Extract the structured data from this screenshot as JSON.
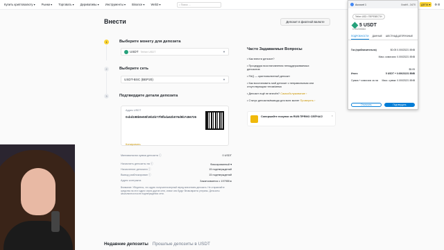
{
  "topnav": {
    "items": [
      "Купить криптовалюту ▾",
      "Рынки ▾",
      "Торговать ▾",
      "Деривативы ▾",
      "Инструменты ▾",
      "Binance ▾",
      "Web3 ▾"
    ],
    "search_placeholder": "Поиск ..."
  },
  "page": {
    "title": "Внести",
    "fiat_button": "Депозит в фиатной валюте"
  },
  "steps": [
    {
      "num": "1",
      "label": "Выберите монету для депозита"
    },
    {
      "num": "2",
      "label": "Выберите сеть"
    },
    {
      "num": "3",
      "label": "Подтвердите детали депозита"
    }
  ],
  "coin_select": {
    "value": "USDT",
    "sub": "Tether USDT"
  },
  "network_select": {
    "value": "USDT-BSC (BEP20)"
  },
  "address": {
    "label": "Адрес USDT",
    "value": "0xbd198b9e55f19b3b77f9fbda62b076d9b7456726",
    "copy": "Копировать"
  },
  "info_rows": [
    {
      "k": "Минимальная сумма депозита ⓘ",
      "v": "0 USDT"
    },
    {
      "k": "Начислить депозиты на ⓘ",
      "v": "Фиксированный ▾"
    },
    {
      "k": "Начисление депозита ⓘ",
      "v": "15 подтверждений"
    },
    {
      "k": "Вывод разблокирован ⓘ",
      "v": "15 подтверждений"
    },
    {
      "k": "Адрес контракта",
      "v": "Заканчивается с 197955 ▸"
    }
  ],
  "note": "Внимание: Убедитесь, что адрес получателя верный перед внесением депозита. Не отправляйте средства на этот адрес через другие сети, иначе они будут безвозвратно утеряны. Депозиты зачисляются после подтверждения сети.",
  "faq": {
    "title": "Часто Задаваемые Вопросы",
    "items": [
      {
        "q": "• Как внести депозит?",
        "link": ""
      },
      {
        "q": "• Процедура восстановления неподдерживаемых депозитов",
        "link": ""
      },
      {
        "q": "• FAQ — криптовалютный депозит",
        "link": ""
      },
      {
        "q": "• Как восстановить мой депозит с неправильным или отсутствующим тегом/мемо",
        "link": ""
      },
      {
        "q": "• Депозит ещё не внесён?",
        "link": "Самообслуживание ›"
      },
      {
        "q": "• Статус депозита/вывода для всех монет",
        "link": "Проверить ›"
      }
    ]
  },
  "promo": {
    "text": "Совершайте покупки за RUB ПРЯМО СЕЙЧАС!",
    "close": "×"
  },
  "bottom_tabs": [
    "Недавние депозиты",
    "Прошлые депозиты в USDT"
  ],
  "topright": {
    "lang": "ДЕПА ▾",
    "icons": "⚙ ☰"
  },
  "wallet": {
    "account": "Account 1",
    "account2": "0xab9...3470",
    "pill": "Tether USD / ПЕРЕВЕСТИ",
    "amount": "5 USDT",
    "fiat": "0.00205584",
    "tabs": [
      "ПОДРОБНОСТИ",
      "ДАННЫЕ",
      "ШЕСТНАДЦАТЕРИЧНЫЕ"
    ],
    "rows": [
      {
        "k": "Газ (приблизительно)",
        "v": "$0.05  0.00023221 BNB"
      },
      {
        "k": "",
        "v": "Макс. комиссия: 0.00023221 BNB"
      },
      {
        "k": "",
        "v": ""
      },
      {
        "k": "",
        "v": "$5.05"
      },
      {
        "k": "Итого",
        "v": "5 USDT + 0.00023221 BNB"
      },
      {
        "k": "Сумма + комиссия за газ",
        "v": "Макс. сумма: 0.00023221 BNB"
      }
    ],
    "reject": "Отклонить",
    "confirm": "Подтвердить"
  }
}
